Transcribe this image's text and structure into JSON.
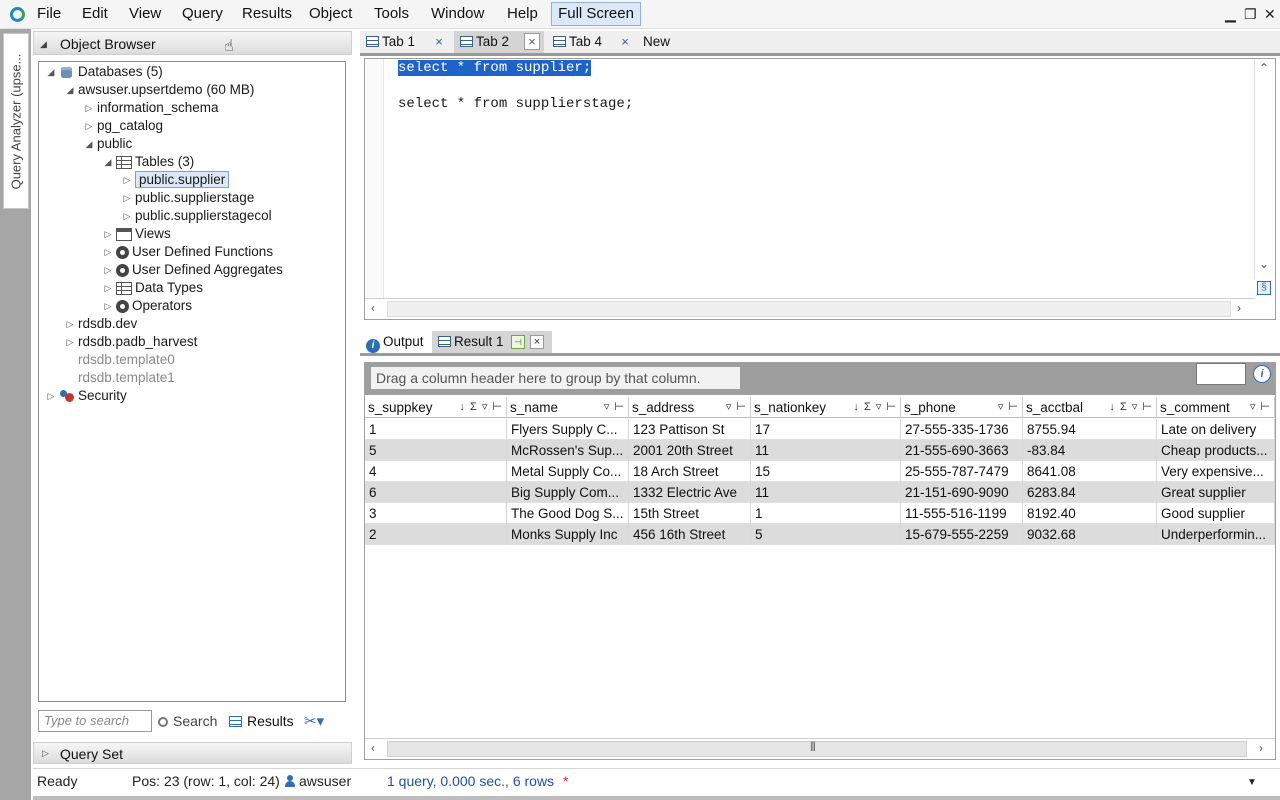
{
  "menu": {
    "items": [
      "File",
      "Edit",
      "View",
      "Query",
      "Results",
      "Object",
      "Tools",
      "Window",
      "Help"
    ],
    "full_screen": "Full Screen"
  },
  "side_strip": {
    "label": "Query Analyzer (upse..."
  },
  "object_browser": {
    "title": "Object Browser",
    "tree": [
      {
        "label": "Databases (5)",
        "icon": "database-icon",
        "expander": "expanded"
      },
      {
        "label": "awsuser.upsertdemo (60 MB)",
        "icon": "",
        "expander": "expanded"
      },
      {
        "label": "information_schema",
        "icon": "",
        "expander": "collapsed"
      },
      {
        "label": "pg_catalog",
        "icon": "",
        "expander": "collapsed"
      },
      {
        "label": "public",
        "icon": "",
        "expander": "expanded"
      },
      {
        "label": "Tables (3)",
        "icon": "table-icon",
        "expander": "expanded"
      },
      {
        "label": "public.supplier",
        "icon": "",
        "expander": "collapsed",
        "selected": true
      },
      {
        "label": "public.supplierstage",
        "icon": "",
        "expander": "collapsed"
      },
      {
        "label": "public.supplierstagecol",
        "icon": "",
        "expander": "collapsed"
      },
      {
        "label": "Views",
        "icon": "view-icon",
        "expander": "collapsed"
      },
      {
        "label": "User Defined Functions",
        "icon": "gear-icon",
        "expander": "collapsed"
      },
      {
        "label": "User Defined Aggregates",
        "icon": "gear-icon",
        "expander": "collapsed"
      },
      {
        "label": "Data Types",
        "icon": "table-icon",
        "expander": "collapsed"
      },
      {
        "label": "Operators",
        "icon": "gear-icon",
        "expander": "collapsed"
      },
      {
        "label": "rdsdb.dev",
        "icon": "",
        "expander": "collapsed"
      },
      {
        "label": "rdsdb.padb_harvest",
        "icon": "",
        "expander": "collapsed"
      },
      {
        "label": "rdsdb.template0",
        "icon": "",
        "expander": "none",
        "dim": true
      },
      {
        "label": "rdsdb.template1",
        "icon": "",
        "expander": "none",
        "dim": true
      },
      {
        "label": "Security",
        "icon": "security-icon",
        "expander": "collapsed"
      }
    ],
    "search_placeholder": "Type to search",
    "search_label": "Search",
    "results_label": "Results"
  },
  "query_set": {
    "title": "Query Set"
  },
  "editor_tabs": [
    {
      "label": "Tab 1"
    },
    {
      "label": "Tab 2",
      "active": true
    },
    {
      "label": "Tab 4"
    }
  ],
  "new_tab_label": "New",
  "close_glyph": "×",
  "editor": {
    "lines": [
      {
        "text": "select * from supplier;",
        "selected": true
      },
      {
        "text": "select * from supplierstage;",
        "selected": false
      }
    ]
  },
  "result_tabs": {
    "output_label": "Output",
    "result_label": "Result 1"
  },
  "grid": {
    "group_hint": "Drag a column header here to group by that column.",
    "columns": [
      {
        "name": "s_suppkey",
        "icons": "↓ Σ ▿ ⊢"
      },
      {
        "name": "s_name",
        "icons": "▿ ⊢"
      },
      {
        "name": "s_address",
        "icons": "▿ ⊢"
      },
      {
        "name": "s_nationkey",
        "icons": "↓ Σ ▿ ⊢"
      },
      {
        "name": "s_phone",
        "icons": "▿ ⊢"
      },
      {
        "name": "s_acctbal",
        "icons": "↓ Σ ▿ ⊢"
      },
      {
        "name": "s_comment",
        "icons": "▿ ⊢"
      }
    ],
    "rows": [
      [
        "1",
        "Flyers Supply C...",
        "123 Pattison St",
        "17",
        "27-555-335-1736",
        "8755.94",
        "Late on delivery"
      ],
      [
        "5",
        "McRossen's Sup...",
        "2001 20th Street",
        "11",
        "21-555-690-3663",
        "-83.84",
        "Cheap products..."
      ],
      [
        "4",
        "Metal Supply Co...",
        "18 Arch Street",
        "15",
        "25-555-787-7479",
        "8641.08",
        "Very expensive..."
      ],
      [
        "6",
        "Big Supply Com...",
        "1332 Electric Ave",
        "11",
        "21-151-690-9090",
        "6283.84",
        "Great supplier"
      ],
      [
        "3",
        "The Good Dog S...",
        "15th Street",
        "1",
        "11-555-516-1199",
        "8192.40",
        "Good supplier"
      ],
      [
        "2",
        "Monks Supply Inc",
        "456 16th Street",
        "5",
        "15-679-555-2259",
        "9032.68",
        " Underperformin..."
      ]
    ]
  },
  "status": {
    "ready": "Ready",
    "pos": "Pos: 23 (row: 1, col: 24)",
    "user": "awsuser",
    "summary": "1 query, 0.000 sec., 6 rows",
    "modified": "*"
  }
}
